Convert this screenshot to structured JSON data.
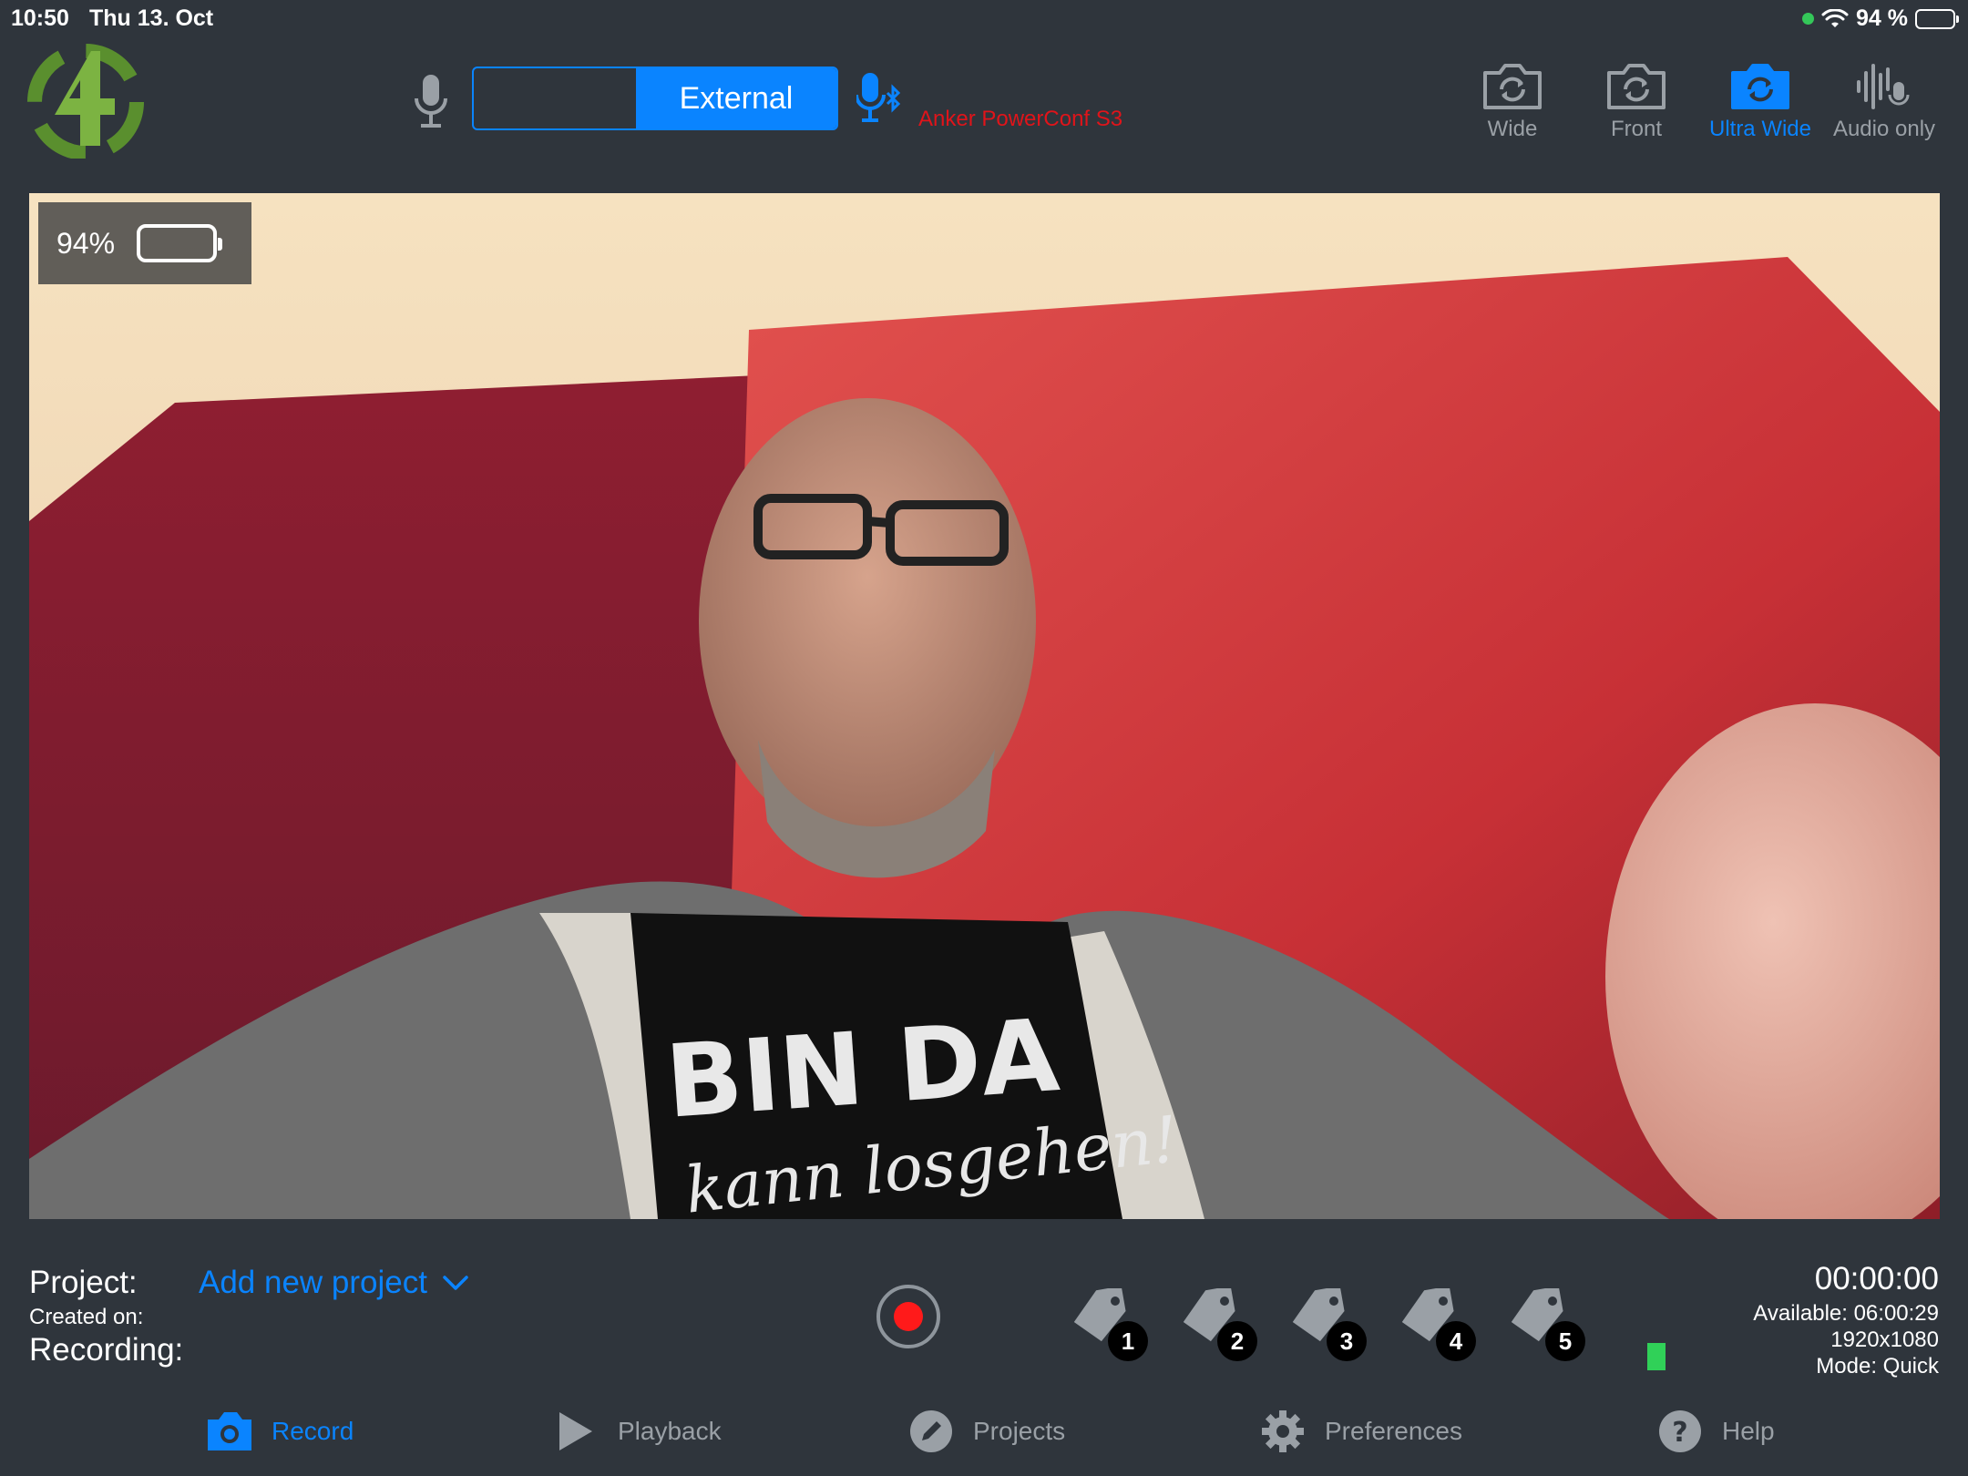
{
  "status_bar": {
    "time": "10:50",
    "date": "Thu 13. Oct",
    "battery_percent": "94 %",
    "battery_level": 0.94,
    "icons": [
      "green-dot-indicator",
      "wifi-icon",
      "battery-icon"
    ]
  },
  "audio_source": {
    "options": [
      "",
      "External"
    ],
    "selected": "External",
    "device_name": "Anker PowerConf S3"
  },
  "cameras": [
    {
      "label": "Wide",
      "active": false,
      "icon": "camera-rotate-icon"
    },
    {
      "label": "Front",
      "active": false,
      "icon": "camera-rotate-icon"
    },
    {
      "label": "Ultra Wide",
      "active": true,
      "icon": "camera-rotate-icon"
    },
    {
      "label": "Audio only",
      "active": false,
      "icon": "waveform-mic-icon"
    }
  ],
  "preview": {
    "battery_overlay": "94%",
    "battery_level": 0.94,
    "shirt_text_1": "BIN DA",
    "shirt_text_2": "kann losgehen!"
  },
  "project": {
    "label": "Project:",
    "value": "Add new project",
    "created_label": "Created on:",
    "recording_label": "Recording:"
  },
  "tags": [
    "1",
    "2",
    "3",
    "4",
    "5"
  ],
  "recording_info": {
    "timecode": "00:00:00",
    "available": "Available: 06:00:29",
    "resolution": "1920x1080",
    "mode": "Mode: Quick"
  },
  "tabs": [
    {
      "label": "Record",
      "active": true,
      "icon": "camera-icon"
    },
    {
      "label": "Playback",
      "active": false,
      "icon": "play-icon"
    },
    {
      "label": "Projects",
      "active": false,
      "icon": "pencil-icon"
    },
    {
      "label": "Preferences",
      "active": false,
      "icon": "gear-icon"
    },
    {
      "label": "Help",
      "active": false,
      "icon": "question-icon"
    }
  ],
  "colors": {
    "background": "#2f353c",
    "accent": "#0a84ff",
    "device_name": "#e0141a",
    "record_dot": "#ff1a1a",
    "battery_fill": "#34c759"
  }
}
